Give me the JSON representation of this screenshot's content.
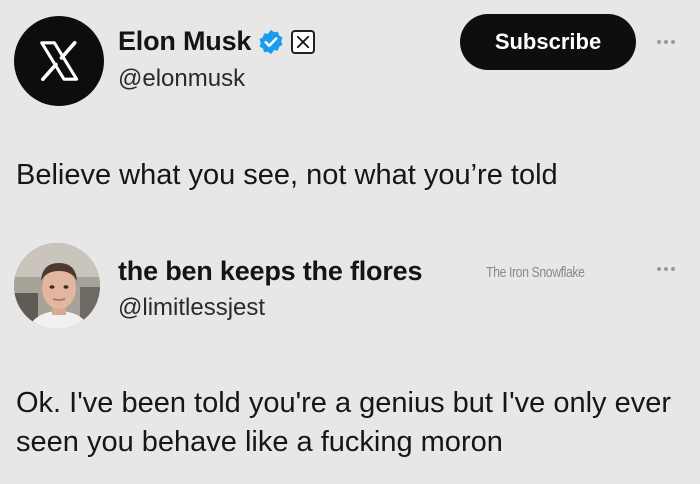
{
  "tweet1": {
    "author": {
      "display_name": "Elon Musk",
      "handle": "@elonmusk",
      "avatar_icon": "x-logo-icon",
      "verified": true,
      "badge_icon": "x-badge-icon"
    },
    "subscribe_label": "Subscribe",
    "text": "Believe what you see, not what you’re told"
  },
  "tweet2": {
    "author": {
      "display_name": "the ben keeps the flores",
      "handle": "@limitlessjest"
    },
    "watermark": "The Iron Snowflake",
    "text": "Ok. I've been told you're a genius but I've only ever seen you behave like a fucking moron"
  },
  "colors": {
    "background": "#e7e7e7",
    "button": "#0e0e0e",
    "verified": "#1d9bf0"
  }
}
